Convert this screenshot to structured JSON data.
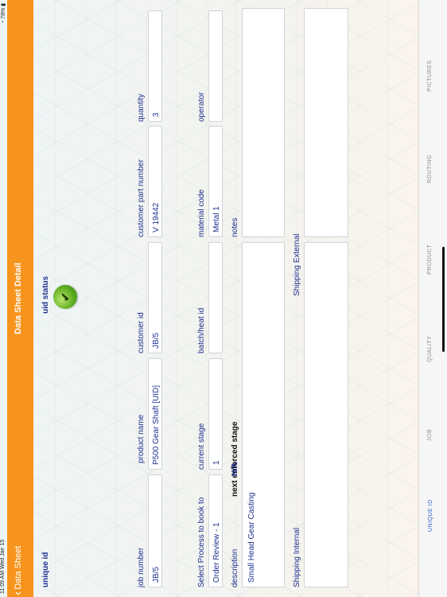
{
  "status_bar": {
    "time": "11:09 AM   Wed Jan 15",
    "battery": "78%"
  },
  "nav": {
    "back_label": "Data Sheet",
    "title": "Data Sheet Detail"
  },
  "form": {
    "unique_id_label": "unique id",
    "uid_status_label": "uid status",
    "job_number": {
      "label": "job number",
      "value": "JB/5"
    },
    "product_name": {
      "label": "product name",
      "value": "P500 Gear Shaft [UID]"
    },
    "customer_id": {
      "label": "customer id",
      "value": "JB/5"
    },
    "customer_part_number": {
      "label": "customer part number",
      "value": "V 19442"
    },
    "quantity": {
      "label": "quantity",
      "value": "3"
    },
    "select_process": {
      "label": "Select Process to book to",
      "value": "Order Review - 1"
    },
    "current_stage": {
      "label": "current stage",
      "value": "1"
    },
    "batch_heat_id": {
      "label": "batch/heat id",
      "value": ""
    },
    "material_code": {
      "label": "material code",
      "value": "Metal 1"
    },
    "operator": {
      "label": "operator",
      "value": ""
    },
    "next_enforced_stage": {
      "label": "next enforced stage",
      "value": "N/A"
    },
    "description": {
      "label": "description",
      "value": "Small Head Gear Casting"
    },
    "notes": {
      "label": "notes",
      "value": ""
    },
    "shipping_internal": {
      "label": "Shipping Internal",
      "value": ""
    },
    "shipping_external": {
      "label": "Shipping External",
      "value": ""
    }
  },
  "tabs": [
    {
      "label": "UNIQUE ID",
      "active": true
    },
    {
      "label": "JOB",
      "active": false
    },
    {
      "label": "QUALITY",
      "active": false
    },
    {
      "label": "PRODUCT",
      "active": false
    },
    {
      "label": "ROUTING",
      "active": false
    },
    {
      "label": "PICTURES",
      "active": false
    }
  ],
  "colors": {
    "nav": "#f7941d",
    "label": "#1d2f8f",
    "active_tab": "#2f64d1",
    "status_ok": "#5fae22"
  },
  "icons": {
    "back": "chevron-left-icon",
    "status": "check-circle-icon"
  }
}
